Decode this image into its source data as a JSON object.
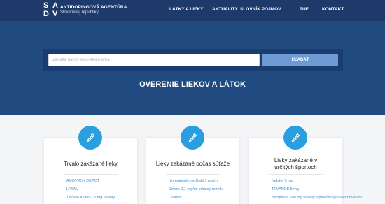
{
  "header": {
    "logo_letters": [
      "S",
      "A",
      "D",
      "V"
    ],
    "brand_line1": "ANTIDOPINGOVÁ AGENTÚRA",
    "brand_line2": "Slovenskej republiky",
    "nav": [
      "LÁTKY A LIEKY",
      "AKTUALITY",
      "SLOVNÍK POJMOV",
      "TUE",
      "KONTAKT"
    ]
  },
  "hero": {
    "search_placeholder": "Zadajte názov lieku alebo látky",
    "search_button": "HĽADAŤ",
    "title": "OVERENIE LIEKOV A LÁTOK"
  },
  "cards": [
    {
      "icon": "dropper-icon",
      "title": "Trvalo zakázané lieky",
      "items": [
        "AGOVIRIN DEPOT",
        "LIVIAL",
        "Tibolón Aristo 2,5 mg tablety"
      ]
    },
    {
      "icon": "dropper-icon",
      "title": "Lieky zakázané počas súťaže",
      "items": [
        "Norepinephrine Kabi 1 mg/ml",
        "Sinora 0,1 mg/ml infúzny roztok",
        "Orabloc"
      ]
    },
    {
      "icon": "dropper-icon",
      "title": "Lieky zakázané v určitých športoch",
      "items": [
        "Nebilet 5 mg",
        "TEVANEB 5 mg",
        "Bisoprolol 200 mg tablety s predĺženým uvoľňovaním"
      ]
    }
  ],
  "colors": {
    "header": "#1d3a6b",
    "hero": "#214a80",
    "accent": "#2a9fe0",
    "button": "#6d9ad3",
    "link": "#3a8fd8"
  }
}
